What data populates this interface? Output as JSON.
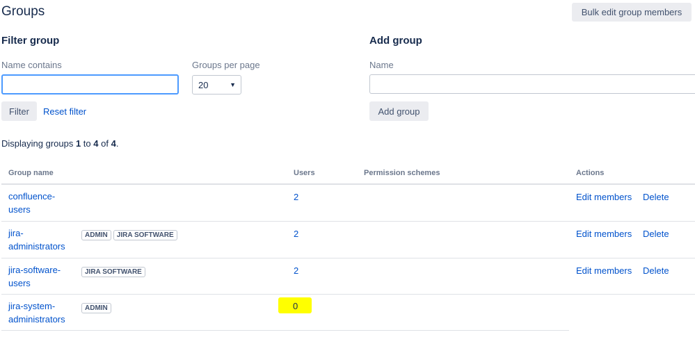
{
  "header": {
    "title": "Groups",
    "bulk_edit_label": "Bulk edit group members"
  },
  "filter": {
    "title": "Filter group",
    "name_label": "Name contains",
    "name_value": "",
    "per_page_label": "Groups per page",
    "per_page_value": "20",
    "filter_button": "Filter",
    "reset_link": "Reset filter"
  },
  "add": {
    "title": "Add group",
    "name_label": "Name",
    "name_value": "",
    "add_button": "Add group"
  },
  "summary": {
    "prefix": "Displaying groups ",
    "from": "1",
    "to_word": " to ",
    "to": "4",
    "of_word": " of ",
    "total": "4",
    "suffix": "."
  },
  "table": {
    "headers": {
      "group_name": "Group name",
      "users": "Users",
      "permission_schemes": "Permission schemes",
      "actions": "Actions"
    },
    "rows": [
      {
        "name_line1": "confluence-",
        "name_line2": "users",
        "badges": [],
        "users": "2",
        "edit": "Edit members",
        "delete": "Delete"
      },
      {
        "name_line1": "jira-",
        "name_line2": "administrators",
        "badges": [
          "ADMIN",
          "JIRA SOFTWARE"
        ],
        "users": "2",
        "edit": "Edit members",
        "delete": "Delete"
      },
      {
        "name_line1": "jira-software-",
        "name_line2": "users",
        "badges": [
          "JIRA SOFTWARE"
        ],
        "users": "2",
        "edit": "Edit members",
        "delete": "Delete"
      },
      {
        "name_line1": "jira-system-",
        "name_line2": "administrators",
        "badges": [
          "ADMIN"
        ],
        "users": "0",
        "edit": "",
        "delete": ""
      }
    ]
  },
  "colors": {
    "link": "#0052cc",
    "highlight": "#ffff00",
    "focus_border": "#4c9aff",
    "button_bg": "#ebecf0"
  }
}
